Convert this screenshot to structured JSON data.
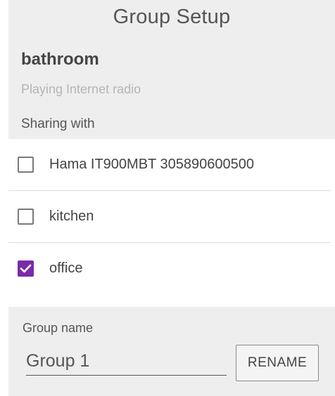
{
  "dialog": {
    "title": "Group Setup"
  },
  "group": {
    "name": "bathroom",
    "status": "Playing Internet radio",
    "sharing_label": "Sharing with"
  },
  "devices": [
    {
      "label": "Hama IT900MBT 305890600500",
      "checked": false
    },
    {
      "label": "kitchen",
      "checked": false
    },
    {
      "label": "office",
      "checked": true
    }
  ],
  "group_name": {
    "label": "Group name",
    "value": "Group 1",
    "rename_label": "RENAME"
  },
  "colors": {
    "panel_bg": "#eeeeee",
    "accent": "#7b2aa8",
    "divider": "#dddddd"
  },
  "icons": {
    "checked": "checkmark-icon"
  }
}
